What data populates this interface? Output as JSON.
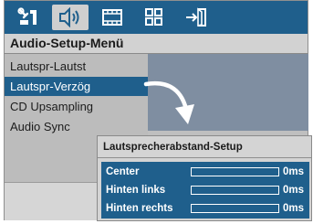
{
  "tabs": [
    {
      "icon": "settings-icon",
      "active": false
    },
    {
      "icon": "speaker-icon",
      "active": true
    },
    {
      "icon": "film-icon",
      "active": false
    },
    {
      "icon": "grid-icon",
      "active": false
    },
    {
      "icon": "exit-icon",
      "active": false
    }
  ],
  "menu": {
    "title": "Audio-Setup-Menü",
    "items": [
      {
        "label": "Lautspr-Lautst",
        "selected": false
      },
      {
        "label": "Lautspr-Verzög",
        "selected": true
      },
      {
        "label": "CD Upsampling",
        "selected": false
      },
      {
        "label": "Audio Sync",
        "selected": false
      }
    ]
  },
  "popup": {
    "title": "Lautsprecherabstand-Setup",
    "rows": [
      {
        "label": "Center",
        "value": "0ms",
        "level": 0
      },
      {
        "label": "Hinten links",
        "value": "0ms",
        "level": 0
      },
      {
        "label": "Hinten rechts",
        "value": "0ms",
        "level": 0
      }
    ]
  },
  "colors": {
    "accent": "#1f5f8c",
    "selected_tab": "#cfcfcf",
    "menu_bg": "#bcbcbc",
    "pane_bg": "#7f8ea1"
  }
}
